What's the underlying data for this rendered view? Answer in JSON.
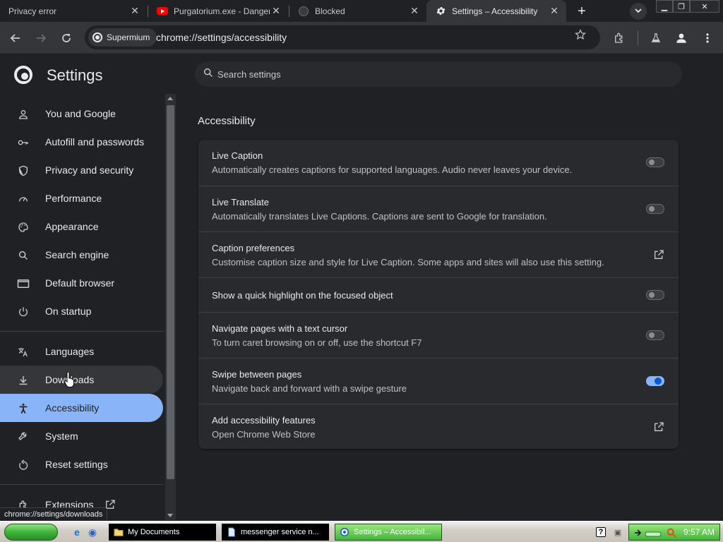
{
  "tabs": [
    {
      "title": "Privacy error",
      "close": "✕"
    },
    {
      "title": "Purgatorium.exe - Danger",
      "close": "✕"
    },
    {
      "title": "Blocked",
      "close": "✕"
    },
    {
      "title": "Settings – Accessibility",
      "close": "✕"
    }
  ],
  "tabstrip": {
    "new_tab": "+",
    "window_min": "▁",
    "window_restore": "❐",
    "window_close": "✕"
  },
  "toolbar": {
    "chip_label": "Supermium",
    "url": "chrome://settings/accessibility"
  },
  "header": {
    "title": "Settings",
    "search_placeholder": "Search settings"
  },
  "sidebar": {
    "items": [
      {
        "label": "You and Google",
        "icon": "person-icon"
      },
      {
        "label": "Autofill and passwords",
        "icon": "key-icon"
      },
      {
        "label": "Privacy and security",
        "icon": "shield-icon"
      },
      {
        "label": "Performance",
        "icon": "speedometer-icon"
      },
      {
        "label": "Appearance",
        "icon": "palette-icon"
      },
      {
        "label": "Search engine",
        "icon": "search-icon"
      },
      {
        "label": "Default browser",
        "icon": "browser-window-icon"
      },
      {
        "label": "On startup",
        "icon": "power-icon"
      },
      {
        "label": "Languages",
        "icon": "translate-icon"
      },
      {
        "label": "Downloads",
        "icon": "download-icon"
      },
      {
        "label": "Accessibility",
        "icon": "accessibility-icon"
      },
      {
        "label": "System",
        "icon": "wrench-icon"
      },
      {
        "label": "Reset settings",
        "icon": "reset-icon"
      },
      {
        "label": "Extensions",
        "icon": "puzzle-icon"
      }
    ]
  },
  "main": {
    "section_title": "Accessibility",
    "rows": [
      {
        "title": "Live Caption",
        "desc": "Automatically creates captions for supported languages. Audio never leaves your device.",
        "control": "toggle",
        "checked": false
      },
      {
        "title": "Live Translate",
        "desc": "Automatically translates Live Captions. Captions are sent to Google for translation.",
        "control": "toggle",
        "checked": false
      },
      {
        "title": "Caption preferences",
        "desc": "Customise caption size and style for Live Caption. Some apps and sites will also use this setting.",
        "control": "external-link"
      },
      {
        "title": "Show a quick highlight on the focused object",
        "desc": "",
        "control": "toggle",
        "checked": false
      },
      {
        "title": "Navigate pages with a text cursor",
        "desc": "To turn caret browsing on or off, use the shortcut F7",
        "control": "toggle",
        "checked": false
      },
      {
        "title": "Swipe between pages",
        "desc": "Navigate back and forward with a swipe gesture",
        "control": "toggle",
        "checked": true
      },
      {
        "title": "Add accessibility features",
        "desc": "Open Chrome Web Store",
        "control": "external-link"
      }
    ]
  },
  "status_bubble": "chrome://settings/downloads",
  "taskbar": {
    "tasks": [
      {
        "label": "My Documents"
      },
      {
        "label": "messenger service n..."
      },
      {
        "label": "Settings – Accessibil..."
      }
    ],
    "clock": "9:57 AM",
    "help_icon_glyph": "?"
  },
  "colors": {
    "accent": "#8ab4f8",
    "background": "#202124",
    "card": "#292a2d",
    "toggle_on_knob": "#0b57d0"
  }
}
